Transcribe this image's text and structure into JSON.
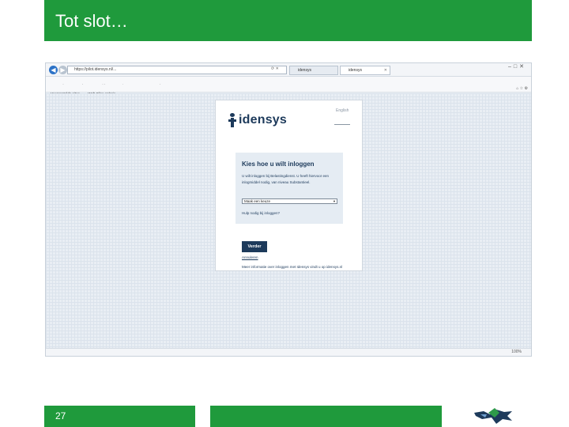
{
  "slide": {
    "title": "Tot slot…",
    "page_number": "27"
  },
  "browser": {
    "address": "https://pilot.idensys.nl/...",
    "tabs": [
      "idensys",
      "idensys"
    ],
    "menu": [
      "Bestand",
      "Bewerken",
      "Beeld",
      "Favorieten",
      "Extra",
      "Help"
    ],
    "favorites": [
      "Voorgestelde sites",
      "Web Slice-galerie"
    ],
    "zoom": "100%"
  },
  "page": {
    "language": "English",
    "logo_text": "idensys",
    "heading": "Kies hoe u wilt inloggen",
    "description": "U wilt inloggen bij Belastingdienst. U heeft hiervoor een inlogmiddel nodig, van niveau Substantieel.",
    "select_value": "Maak een keuze",
    "help_link": "Hulp nodig bij inloggen?",
    "next_button": "Verder",
    "back_link": "Annuleren",
    "footer_text": "Meer informatie over inloggen met Idensys vindt u op idensys.nl"
  }
}
